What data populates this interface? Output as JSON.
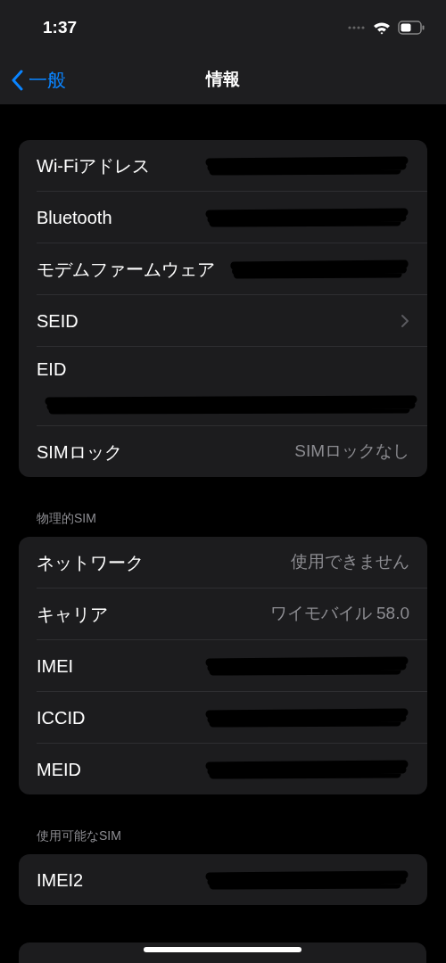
{
  "status_bar": {
    "time": "1:37"
  },
  "nav": {
    "back": "一般",
    "title": "情報"
  },
  "sections": [
    {
      "rows": [
        {
          "kind": "redacted",
          "label": "Wi-Fiアドレス"
        },
        {
          "kind": "redacted",
          "label": "Bluetooth"
        },
        {
          "kind": "redacted",
          "label": "モデムファームウェア"
        },
        {
          "kind": "link",
          "label": "SEID"
        },
        {
          "kind": "redacted_below",
          "label": "EID"
        },
        {
          "kind": "value",
          "label": "SIMロック",
          "value": "SIMロックなし"
        }
      ]
    },
    {
      "header": "物理的SIM",
      "rows": [
        {
          "kind": "value",
          "label": "ネットワーク",
          "value": "使用できません"
        },
        {
          "kind": "value",
          "label": "キャリア",
          "value": "ワイモバイル 58.0"
        },
        {
          "kind": "redacted",
          "label": "IMEI"
        },
        {
          "kind": "redacted",
          "label": "ICCID"
        },
        {
          "kind": "redacted",
          "label": "MEID"
        }
      ]
    },
    {
      "header": "使用可能なSIM",
      "rows": [
        {
          "kind": "redacted",
          "label": "IMEI2"
        }
      ]
    }
  ]
}
